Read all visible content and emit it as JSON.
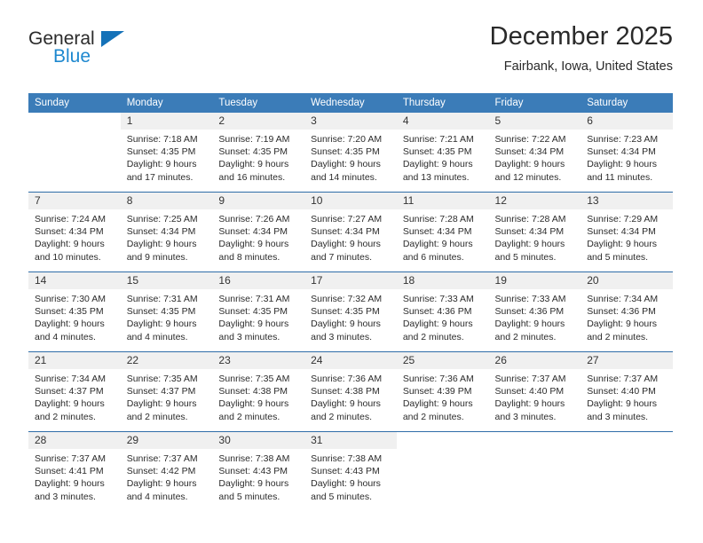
{
  "logo": {
    "word_one": "General",
    "word_two": "Blue",
    "triangle_color": "#1572b8"
  },
  "header": {
    "month_title": "December 2025",
    "location": "Fairbank, Iowa, United States"
  },
  "theme": {
    "header_row_bg": "#3b7cb8",
    "header_row_text": "#ffffff",
    "daynum_bg": "#f0f0f0",
    "grid_line": "#2f6da8"
  },
  "calendar": {
    "weekday_headers": [
      "Sunday",
      "Monday",
      "Tuesday",
      "Wednesday",
      "Thursday",
      "Friday",
      "Saturday"
    ],
    "labels": {
      "sunrise": "Sunrise:",
      "sunset": "Sunset:",
      "daylight": "Daylight:"
    },
    "weeks": [
      [
        {
          "day": "",
          "sunrise": "",
          "sunset": "",
          "daylight_line1": "",
          "daylight_line2": ""
        },
        {
          "day": "1",
          "sunrise": "Sunrise: 7:18 AM",
          "sunset": "Sunset: 4:35 PM",
          "daylight_line1": "Daylight: 9 hours",
          "daylight_line2": "and 17 minutes."
        },
        {
          "day": "2",
          "sunrise": "Sunrise: 7:19 AM",
          "sunset": "Sunset: 4:35 PM",
          "daylight_line1": "Daylight: 9 hours",
          "daylight_line2": "and 16 minutes."
        },
        {
          "day": "3",
          "sunrise": "Sunrise: 7:20 AM",
          "sunset": "Sunset: 4:35 PM",
          "daylight_line1": "Daylight: 9 hours",
          "daylight_line2": "and 14 minutes."
        },
        {
          "day": "4",
          "sunrise": "Sunrise: 7:21 AM",
          "sunset": "Sunset: 4:35 PM",
          "daylight_line1": "Daylight: 9 hours",
          "daylight_line2": "and 13 minutes."
        },
        {
          "day": "5",
          "sunrise": "Sunrise: 7:22 AM",
          "sunset": "Sunset: 4:34 PM",
          "daylight_line1": "Daylight: 9 hours",
          "daylight_line2": "and 12 minutes."
        },
        {
          "day": "6",
          "sunrise": "Sunrise: 7:23 AM",
          "sunset": "Sunset: 4:34 PM",
          "daylight_line1": "Daylight: 9 hours",
          "daylight_line2": "and 11 minutes."
        }
      ],
      [
        {
          "day": "7",
          "sunrise": "Sunrise: 7:24 AM",
          "sunset": "Sunset: 4:34 PM",
          "daylight_line1": "Daylight: 9 hours",
          "daylight_line2": "and 10 minutes."
        },
        {
          "day": "8",
          "sunrise": "Sunrise: 7:25 AM",
          "sunset": "Sunset: 4:34 PM",
          "daylight_line1": "Daylight: 9 hours",
          "daylight_line2": "and 9 minutes."
        },
        {
          "day": "9",
          "sunrise": "Sunrise: 7:26 AM",
          "sunset": "Sunset: 4:34 PM",
          "daylight_line1": "Daylight: 9 hours",
          "daylight_line2": "and 8 minutes."
        },
        {
          "day": "10",
          "sunrise": "Sunrise: 7:27 AM",
          "sunset": "Sunset: 4:34 PM",
          "daylight_line1": "Daylight: 9 hours",
          "daylight_line2": "and 7 minutes."
        },
        {
          "day": "11",
          "sunrise": "Sunrise: 7:28 AM",
          "sunset": "Sunset: 4:34 PM",
          "daylight_line1": "Daylight: 9 hours",
          "daylight_line2": "and 6 minutes."
        },
        {
          "day": "12",
          "sunrise": "Sunrise: 7:28 AM",
          "sunset": "Sunset: 4:34 PM",
          "daylight_line1": "Daylight: 9 hours",
          "daylight_line2": "and 5 minutes."
        },
        {
          "day": "13",
          "sunrise": "Sunrise: 7:29 AM",
          "sunset": "Sunset: 4:34 PM",
          "daylight_line1": "Daylight: 9 hours",
          "daylight_line2": "and 5 minutes."
        }
      ],
      [
        {
          "day": "14",
          "sunrise": "Sunrise: 7:30 AM",
          "sunset": "Sunset: 4:35 PM",
          "daylight_line1": "Daylight: 9 hours",
          "daylight_line2": "and 4 minutes."
        },
        {
          "day": "15",
          "sunrise": "Sunrise: 7:31 AM",
          "sunset": "Sunset: 4:35 PM",
          "daylight_line1": "Daylight: 9 hours",
          "daylight_line2": "and 4 minutes."
        },
        {
          "day": "16",
          "sunrise": "Sunrise: 7:31 AM",
          "sunset": "Sunset: 4:35 PM",
          "daylight_line1": "Daylight: 9 hours",
          "daylight_line2": "and 3 minutes."
        },
        {
          "day": "17",
          "sunrise": "Sunrise: 7:32 AM",
          "sunset": "Sunset: 4:35 PM",
          "daylight_line1": "Daylight: 9 hours",
          "daylight_line2": "and 3 minutes."
        },
        {
          "day": "18",
          "sunrise": "Sunrise: 7:33 AM",
          "sunset": "Sunset: 4:36 PM",
          "daylight_line1": "Daylight: 9 hours",
          "daylight_line2": "and 2 minutes."
        },
        {
          "day": "19",
          "sunrise": "Sunrise: 7:33 AM",
          "sunset": "Sunset: 4:36 PM",
          "daylight_line1": "Daylight: 9 hours",
          "daylight_line2": "and 2 minutes."
        },
        {
          "day": "20",
          "sunrise": "Sunrise: 7:34 AM",
          "sunset": "Sunset: 4:36 PM",
          "daylight_line1": "Daylight: 9 hours",
          "daylight_line2": "and 2 minutes."
        }
      ],
      [
        {
          "day": "21",
          "sunrise": "Sunrise: 7:34 AM",
          "sunset": "Sunset: 4:37 PM",
          "daylight_line1": "Daylight: 9 hours",
          "daylight_line2": "and 2 minutes."
        },
        {
          "day": "22",
          "sunrise": "Sunrise: 7:35 AM",
          "sunset": "Sunset: 4:37 PM",
          "daylight_line1": "Daylight: 9 hours",
          "daylight_line2": "and 2 minutes."
        },
        {
          "day": "23",
          "sunrise": "Sunrise: 7:35 AM",
          "sunset": "Sunset: 4:38 PM",
          "daylight_line1": "Daylight: 9 hours",
          "daylight_line2": "and 2 minutes."
        },
        {
          "day": "24",
          "sunrise": "Sunrise: 7:36 AM",
          "sunset": "Sunset: 4:38 PM",
          "daylight_line1": "Daylight: 9 hours",
          "daylight_line2": "and 2 minutes."
        },
        {
          "day": "25",
          "sunrise": "Sunrise: 7:36 AM",
          "sunset": "Sunset: 4:39 PM",
          "daylight_line1": "Daylight: 9 hours",
          "daylight_line2": "and 2 minutes."
        },
        {
          "day": "26",
          "sunrise": "Sunrise: 7:37 AM",
          "sunset": "Sunset: 4:40 PM",
          "daylight_line1": "Daylight: 9 hours",
          "daylight_line2": "and 3 minutes."
        },
        {
          "day": "27",
          "sunrise": "Sunrise: 7:37 AM",
          "sunset": "Sunset: 4:40 PM",
          "daylight_line1": "Daylight: 9 hours",
          "daylight_line2": "and 3 minutes."
        }
      ],
      [
        {
          "day": "28",
          "sunrise": "Sunrise: 7:37 AM",
          "sunset": "Sunset: 4:41 PM",
          "daylight_line1": "Daylight: 9 hours",
          "daylight_line2": "and 3 minutes."
        },
        {
          "day": "29",
          "sunrise": "Sunrise: 7:37 AM",
          "sunset": "Sunset: 4:42 PM",
          "daylight_line1": "Daylight: 9 hours",
          "daylight_line2": "and 4 minutes."
        },
        {
          "day": "30",
          "sunrise": "Sunrise: 7:38 AM",
          "sunset": "Sunset: 4:43 PM",
          "daylight_line1": "Daylight: 9 hours",
          "daylight_line2": "and 5 minutes."
        },
        {
          "day": "31",
          "sunrise": "Sunrise: 7:38 AM",
          "sunset": "Sunset: 4:43 PM",
          "daylight_line1": "Daylight: 9 hours",
          "daylight_line2": "and 5 minutes."
        },
        {
          "day": "",
          "sunrise": "",
          "sunset": "",
          "daylight_line1": "",
          "daylight_line2": ""
        },
        {
          "day": "",
          "sunrise": "",
          "sunset": "",
          "daylight_line1": "",
          "daylight_line2": ""
        },
        {
          "day": "",
          "sunrise": "",
          "sunset": "",
          "daylight_line1": "",
          "daylight_line2": ""
        }
      ]
    ]
  }
}
